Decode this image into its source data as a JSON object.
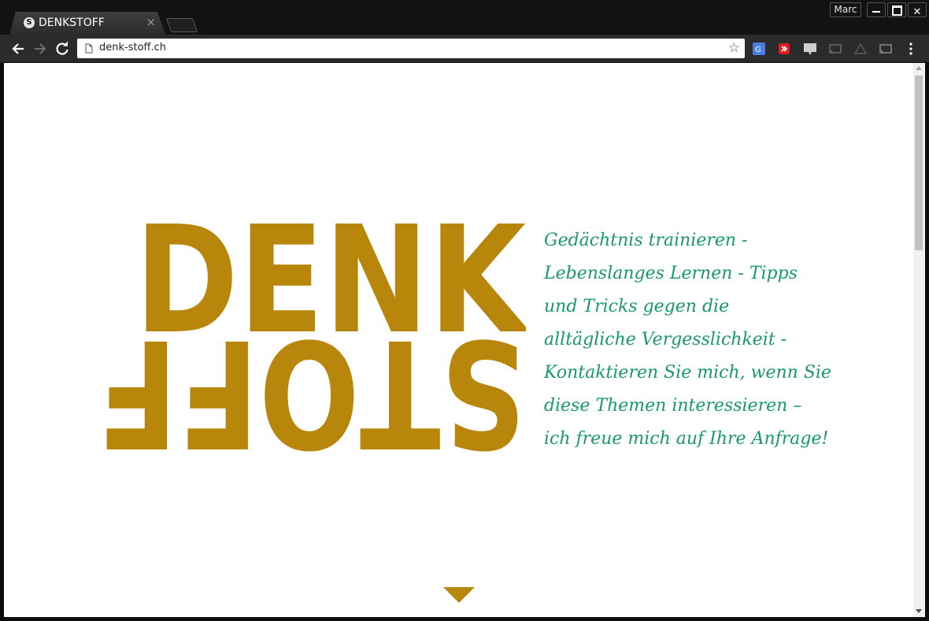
{
  "browser": {
    "tab": {
      "favicon_letter": "S",
      "title": "DENKSTOFF",
      "close_glyph": "×"
    },
    "profile_name": "Marc",
    "window_close_glyph": "✕",
    "address_bar": {
      "url": "denk-stoff.ch",
      "bookmark_glyph": "☆"
    },
    "extensions": [
      "translate-icon",
      "red-extension-icon",
      "rss-icon",
      "cast-icon",
      "drive-icon",
      "cast-icon-2"
    ]
  },
  "page": {
    "logo": {
      "top_word": "DENK",
      "bottom_word": "STOFF",
      "color": "#b8860b"
    },
    "tagline": {
      "color": "#189a68",
      "lines": [
        "Gedächtnis trainieren -",
        "Lebenslanges Lernen - Tipps",
        "und Tricks gegen die",
        "alltägliche Vergesslichkeit -",
        "Kontaktieren Sie mich, wenn Sie",
        "diese Themen interessieren –",
        "ich freue mich auf Ihre Anfrage!"
      ]
    },
    "scroll_down_arrow_color": "#b8860b"
  },
  "scrollbar": {
    "position_fraction": 0.0
  }
}
